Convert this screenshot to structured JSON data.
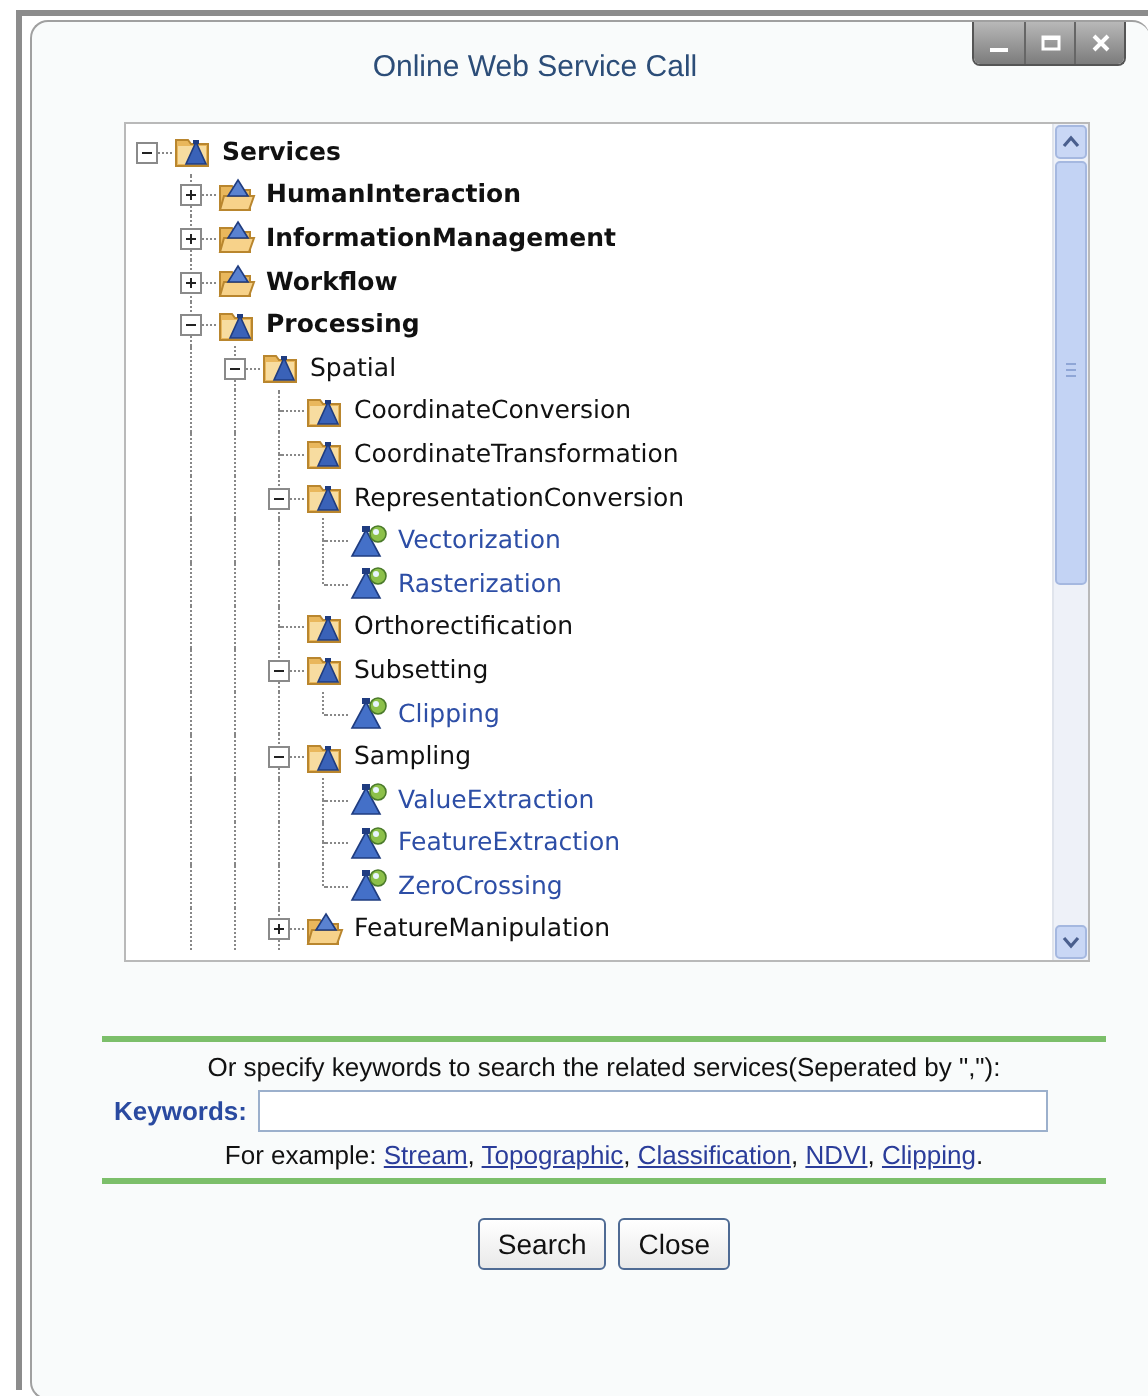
{
  "window": {
    "title": "Online Web Service Call",
    "controls": [
      {
        "kind": "minimize"
      },
      {
        "kind": "maximize"
      },
      {
        "kind": "close"
      }
    ]
  },
  "tree": [
    {
      "label": "Services",
      "kind": "folder",
      "expanded": true,
      "children": [
        {
          "label": "HumanInteraction",
          "kind": "folder",
          "expanded": false
        },
        {
          "label": "InformationManagement",
          "kind": "folder",
          "expanded": false
        },
        {
          "label": "Workflow",
          "kind": "folder",
          "expanded": false
        },
        {
          "label": "Processing",
          "kind": "folder",
          "expanded": true,
          "children": [
            {
              "label": "Spatial",
              "kind": "folder",
              "expanded": true,
              "children": [
                {
                  "label": "CoordinateConversion",
                  "kind": "folder"
                },
                {
                  "label": "CoordinateTransformation",
                  "kind": "folder"
                },
                {
                  "label": "RepresentationConversion",
                  "kind": "folder",
                  "expanded": true,
                  "children": [
                    {
                      "label": "Vectorization",
                      "kind": "service"
                    },
                    {
                      "label": "Rasterization",
                      "kind": "service"
                    }
                  ]
                },
                {
                  "label": "Orthorectification",
                  "kind": "folder"
                },
                {
                  "label": "Subsetting",
                  "kind": "folder",
                  "expanded": true,
                  "children": [
                    {
                      "label": "Clipping",
                      "kind": "service"
                    }
                  ]
                },
                {
                  "label": "Sampling",
                  "kind": "folder",
                  "expanded": true,
                  "children": [
                    {
                      "label": "ValueExtraction",
                      "kind": "service"
                    },
                    {
                      "label": "FeatureExtraction",
                      "kind": "service"
                    },
                    {
                      "label": "ZeroCrossing",
                      "kind": "service"
                    }
                  ]
                },
                {
                  "label": "FeatureManipulation",
                  "kind": "folder",
                  "expanded": false
                }
              ]
            }
          ]
        }
      ]
    }
  ],
  "search": {
    "instruction": "Or specify keywords to search the related services(Seperated by \",\"):",
    "label": "Keywords:",
    "example_prefix": "For example:",
    "examples": [
      "Stream",
      "Topographic",
      "Classification",
      "NDVI",
      "Clipping"
    ],
    "example_separator": ",",
    "example_end": "."
  },
  "buttons": [
    "Search",
    "Close"
  ]
}
